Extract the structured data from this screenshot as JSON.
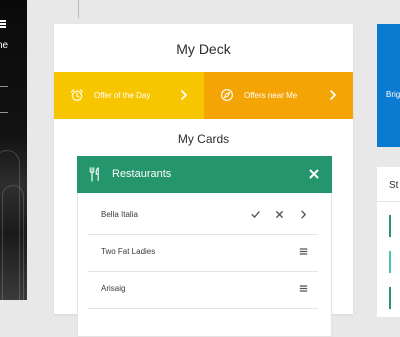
{
  "deck": {
    "title": "My Deck",
    "offers": [
      {
        "label": "Offer of the Day",
        "icon": "alarm-clock-icon",
        "color": "#f8c600"
      },
      {
        "label": "Offers near Me",
        "icon": "compass-icon",
        "color": "#f5a405"
      }
    ],
    "cards_heading": "My Cards"
  },
  "restaurants": {
    "title": "Restaurants",
    "color": "#24956c",
    "items": [
      {
        "name": "Bella Italia",
        "actions": [
          "check-icon",
          "close-icon",
          "chevron-right-icon"
        ]
      },
      {
        "name": "Two Fat Ladies",
        "actions": [
          "drag-handle-icon"
        ]
      },
      {
        "name": "Arisaig",
        "actions": [
          "drag-handle-icon"
        ]
      }
    ]
  },
  "left_panel": {
    "text": "ne"
  },
  "right_column": {
    "blue_card_text": "Brig",
    "blue_card_color": "#0a7bd0",
    "white_card_heading": "St",
    "accent_colors": [
      "#24956c",
      "#4cc3b0",
      "#24956c"
    ]
  }
}
